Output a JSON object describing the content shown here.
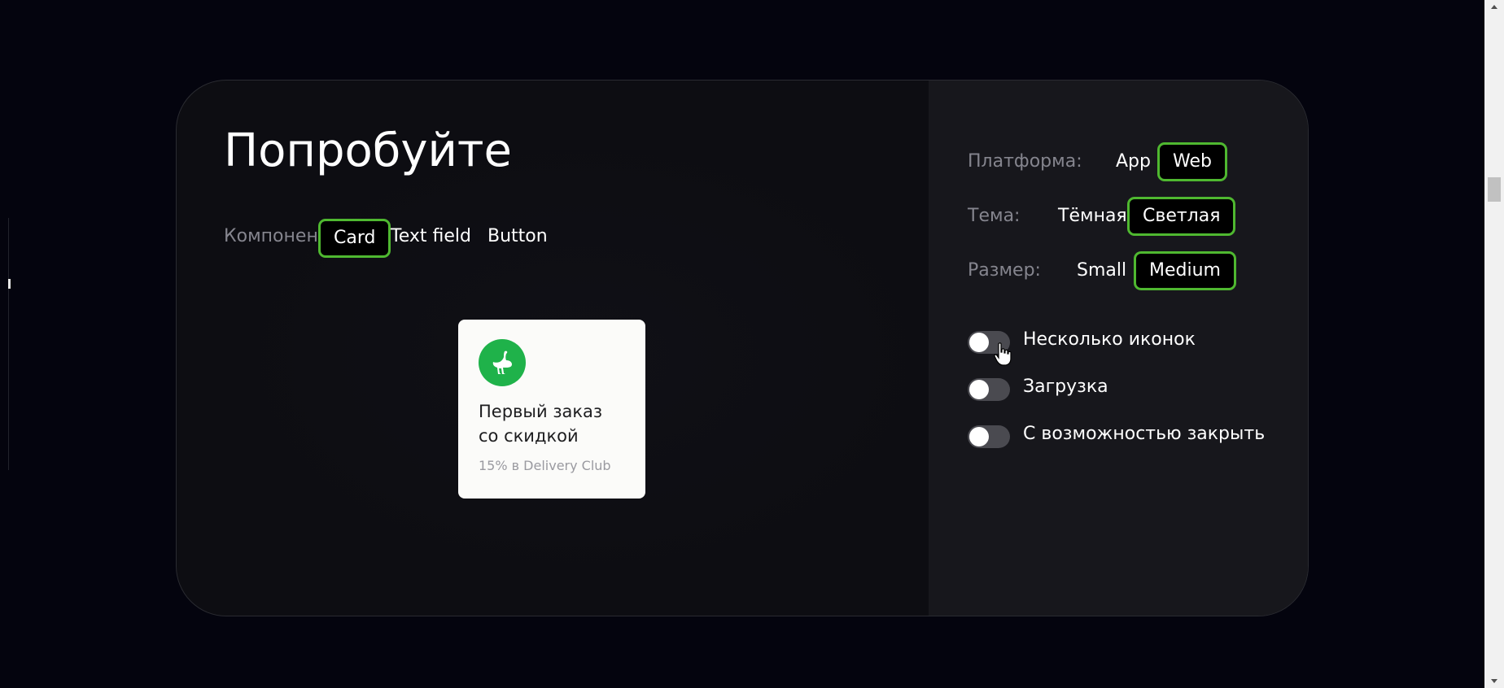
{
  "title": "Попробуйте",
  "component": {
    "label": "Компонент:",
    "options": [
      "Card",
      "Text field",
      "Button"
    ],
    "selected": "Card"
  },
  "platform": {
    "label": "Платформа:",
    "options": [
      "App",
      "Web"
    ],
    "selected": "Web"
  },
  "theme": {
    "label": "Тема:",
    "options": [
      "Тёмная",
      "Светлая"
    ],
    "selected": "Светлая"
  },
  "size": {
    "label": "Размер:",
    "options": [
      "Small",
      "Medium"
    ],
    "selected": "Medium"
  },
  "toggles": [
    {
      "label": "Несколько иконок",
      "on": false
    },
    {
      "label": "Загрузка",
      "on": false
    },
    {
      "label": "С возможностью закрыть",
      "on": false
    }
  ],
  "card": {
    "icon": "ostrich-icon",
    "title_line1": "Первый заказ",
    "title_line2": "со скидкой",
    "subtitle": "15% в Delivery Club"
  },
  "colors": {
    "accent_start": "#2e9a2b",
    "accent_end": "#9be02a",
    "card_icon_bg": "#1fb24a",
    "page_bg": "#04040e"
  }
}
